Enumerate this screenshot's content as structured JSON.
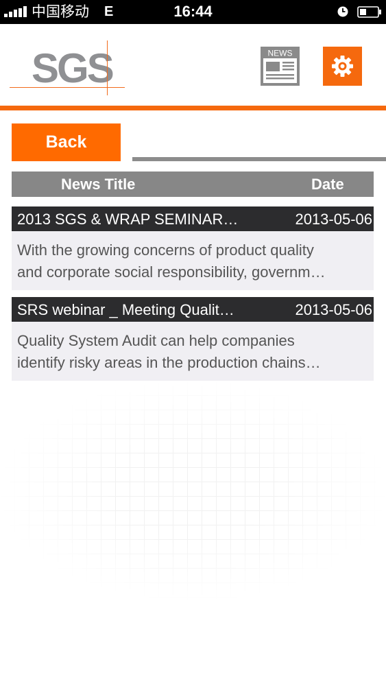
{
  "status_bar": {
    "carrier": "中国移动",
    "network": "E",
    "time": "16:44",
    "icons": [
      "signal-icon",
      "alarm-icon",
      "battery-icon"
    ]
  },
  "header": {
    "logo_text": "SGS",
    "news_icon_text": "NEWS",
    "icons": [
      "news-icon",
      "gear-icon"
    ]
  },
  "back_button": {
    "label": "Back"
  },
  "table": {
    "columns": [
      "News Title",
      "Date"
    ]
  },
  "news": [
    {
      "title": "2013 SGS & WRAP SEMINAR…",
      "date": "2013-05-06",
      "summary_lines": [
        "With the growing concerns of product quality",
        "and corporate social responsibility, governm…"
      ]
    },
    {
      "title": "SRS webinar _ Meeting Qualit…",
      "date": "2013-05-06",
      "summary_lines": [
        "Quality System Audit can help companies",
        "identify risky areas in the production chains…"
      ]
    }
  ],
  "colors": {
    "accent": "#f5690e",
    "header_gray": "#878787",
    "row_dark": "#2c2c2e",
    "row_body": "#f0eff3"
  }
}
